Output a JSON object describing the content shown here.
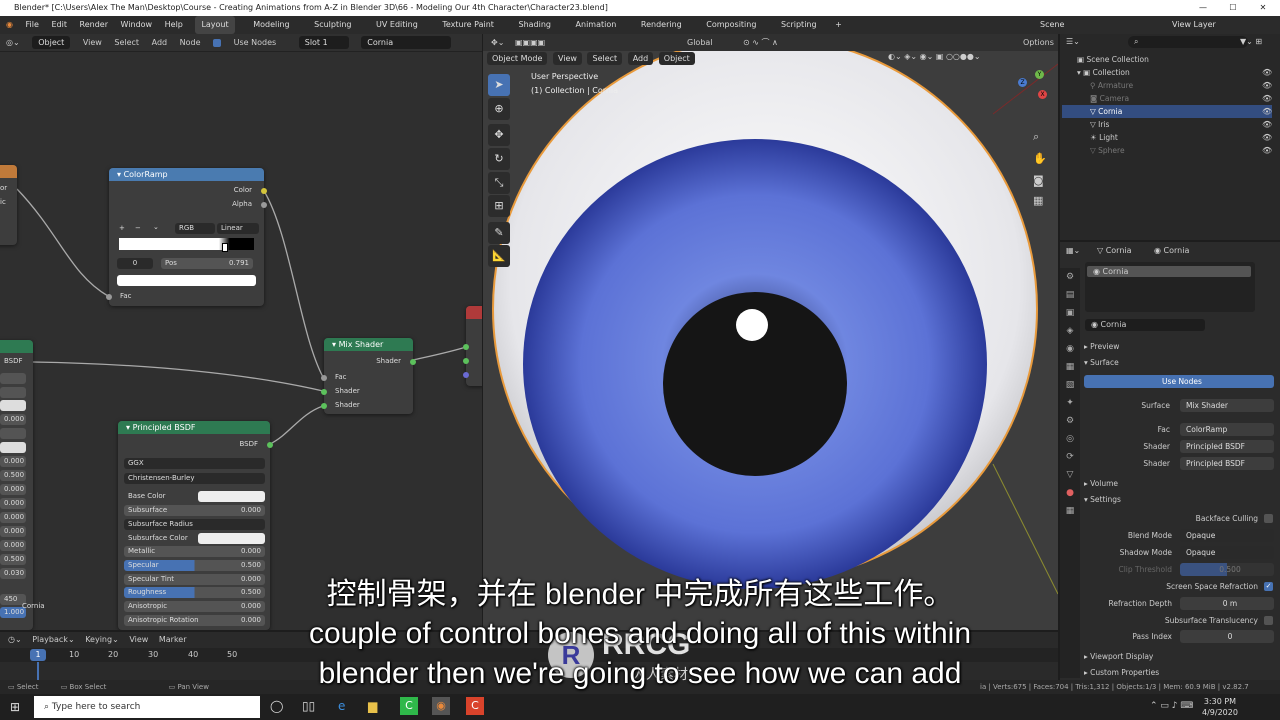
{
  "window": {
    "title": "Blender* [C:\\Users\\Alex The Man\\Desktop\\Course - Creating Animations from A-Z in Blender 3D\\66 - Modeling Our 4th Character\\Character23.blend]",
    "minimize": "—",
    "maximize": "☐",
    "close": "✕"
  },
  "menu": {
    "items": [
      "File",
      "Edit",
      "Render",
      "Window",
      "Help"
    ],
    "workspaces": [
      "Layout",
      "Modeling",
      "Sculpting",
      "UV Editing",
      "Texture Paint",
      "Shading",
      "Animation",
      "Rendering",
      "Compositing",
      "Scripting"
    ],
    "active_workspace": "Layout",
    "add_tab": "+",
    "scene": "Scene",
    "view_layer": "View Layer"
  },
  "node_editor": {
    "header": {
      "object": "Object",
      "view": "View",
      "select": "Select",
      "add": "Add",
      "node": "Node",
      "use_nodes": "Use Nodes",
      "slot": "Slot 1",
      "material": "Cornia"
    },
    "colorramp": {
      "title": "ColorRamp",
      "out_color": "Color",
      "out_alpha": "Alpha",
      "plus": "+",
      "minus": "−",
      "chev": "⌄",
      "mode": "RGB",
      "interp": "Linear",
      "index": "0",
      "pos_label": "Pos",
      "pos_value": "0.791",
      "in_fac": "Fac"
    },
    "mix_shader": {
      "title": "Mix Shader",
      "out": "Shader",
      "fac": "Fac",
      "shader1": "Shader",
      "shader2": "Shader"
    },
    "principled": {
      "title": "Principled BSDF",
      "out": "BSDF",
      "distribution": "GGX",
      "sss_method": "Christensen-Burley",
      "rows": [
        {
          "label": "Base Color",
          "value": ""
        },
        {
          "label": "Subsurface",
          "value": "0.000"
        },
        {
          "label": "Subsurface Radius",
          "value": ""
        },
        {
          "label": "Subsurface Color",
          "value": ""
        },
        {
          "label": "Metallic",
          "value": "0.000"
        },
        {
          "label": "Specular",
          "value": "0.500"
        },
        {
          "label": "Specular Tint",
          "value": "0.000"
        },
        {
          "label": "Roughness",
          "value": "0.500"
        },
        {
          "label": "Anisotropic",
          "value": "0.000"
        },
        {
          "label": "Anisotropic Rotation",
          "value": "0.000"
        }
      ]
    },
    "left_partial": {
      "labels": [
        "or",
        "ic"
      ],
      "bsdf": "BSDF",
      "values": [
        "0.000",
        "0.000",
        "0.000",
        "0.500",
        "0.000",
        "0.000",
        "0.000",
        "0.000",
        "0.500",
        "0.030",
        "450"
      ],
      "cornia": "Cornia",
      "last": "1.000"
    }
  },
  "viewport": {
    "header": {
      "mode": "Object Mode",
      "view": "View",
      "select": "Select",
      "add": "Add",
      "object": "Object",
      "orientation": "Global",
      "options": "Options"
    },
    "perspective": "User Perspective",
    "collection_info": "(1) Collection | Cornia",
    "gizmo": {
      "x": "X",
      "y": "Y",
      "z": "Z"
    }
  },
  "outliner": {
    "scene_collection": "Scene Collection",
    "collection": "Collection",
    "items": [
      {
        "name": "Armature",
        "dim": true
      },
      {
        "name": "Camera",
        "dim": true
      },
      {
        "name": "Cornia",
        "dim": false,
        "selected": true
      },
      {
        "name": "Iris",
        "dim": false
      },
      {
        "name": "Light",
        "dim": false
      },
      {
        "name": "Sphere",
        "dim": true
      }
    ]
  },
  "properties": {
    "object_name": "Cornia",
    "material_name": "Cornia",
    "slot_item": "Cornia",
    "material_field": "Cornia",
    "preview": "Preview",
    "surface": "Surface",
    "use_nodes": "Use Nodes",
    "rows": [
      {
        "label": "Surface",
        "value": "Mix Shader"
      },
      {
        "label": "Fac",
        "value": "ColorRamp"
      },
      {
        "label": "Shader",
        "value": "Principled BSDF"
      },
      {
        "label": "Shader",
        "value": "Principled BSDF"
      }
    ],
    "volume": "Volume",
    "settings": "Settings",
    "backface_culling": "Backface Culling",
    "blend_mode_label": "Blend Mode",
    "blend_mode": "Opaque",
    "shadow_mode_label": "Shadow Mode",
    "shadow_mode": "Opaque",
    "clip_threshold_label": "Clip Threshold",
    "clip_threshold": "0.500",
    "ssr": "Screen Space Refraction",
    "refraction_depth_label": "Refraction Depth",
    "refraction_depth": "0 m",
    "sss_translucency": "Subsurface Translucency",
    "pass_index_label": "Pass Index",
    "pass_index": "0",
    "viewport_display": "Viewport Display",
    "custom_properties": "Custom Properties"
  },
  "timeline": {
    "playback": "Playback",
    "keying": "Keying",
    "view": "View",
    "marker": "Marker",
    "current_frame": "1",
    "ticks": [
      "10",
      "20",
      "30",
      "40",
      "50"
    ]
  },
  "statusbar": {
    "select": "Select",
    "box_select": "Box Select",
    "pan_view": "Pan View",
    "stats": "ia | Verts:675 | Faces:704 | Tris:1,312 | Objects:1/3 | Mem: 60.9 MiB | v2.82.7"
  },
  "taskbar": {
    "search": "Type here to search",
    "time": "3:30 PM",
    "date": "4/9/2020"
  },
  "subtitles": {
    "line_cn": "控制骨架，并在 blender 中完成所有这些工作。",
    "line_en1": "couple of control bones and doing all of this within",
    "line_en2": "blender then we're going to see how we can add"
  },
  "watermark": {
    "logo_text": "RRCG",
    "sub_text": "人人素材"
  },
  "colors": {
    "accent": "#4772b3",
    "iris": "#4a63c8",
    "node_blue": "#4a7bb0",
    "node_green": "#2e7a52"
  }
}
